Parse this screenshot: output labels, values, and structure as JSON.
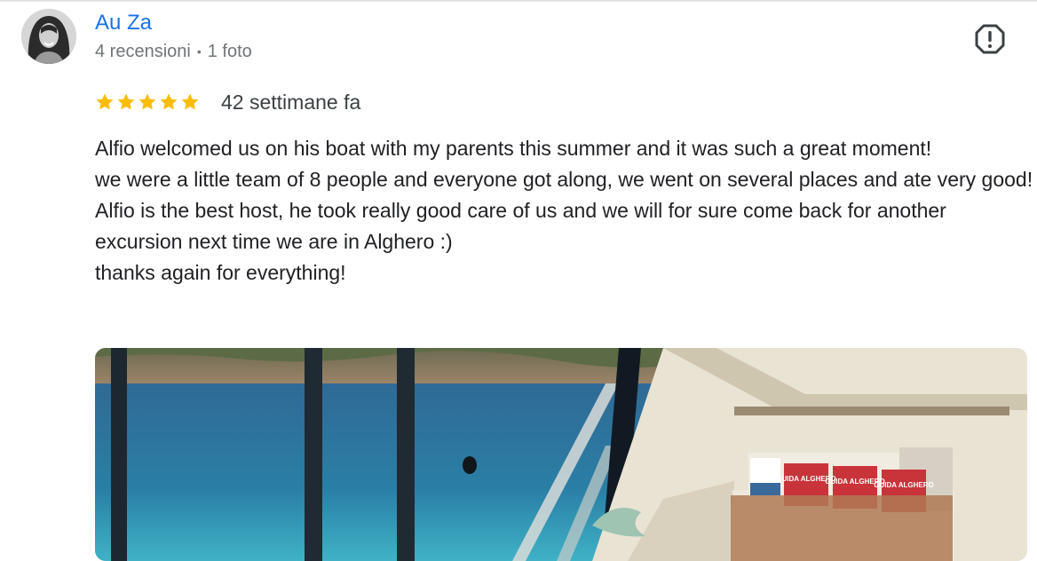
{
  "review": {
    "author_name": "Au Za",
    "author_reviews": "4 recensioni",
    "separator": "•",
    "author_photos": "1 foto",
    "rating": 5,
    "rating_max": 5,
    "time_ago": "42 settimane fa",
    "text_lines": [
      "Alfio welcomed us on his boat with my parents this summer and it was such a great moment!",
      "we were a little team of 8 people and everyone got along, we went on several places and ate very good!",
      "Alfio is the best host, he took really good care of us and we will for sure come back for another excursion next time we are in Alghero :)",
      "thanks again for everything!"
    ]
  },
  "photo": {
    "sign_labels": [
      "GUIDA ALGHERO",
      "GUIDA ALGHERO",
      "GUIDA ALGHERO"
    ]
  },
  "icons": {
    "report": "report-icon",
    "star": "star-icon",
    "avatar": "avatar"
  },
  "colors": {
    "link": "#1a73e8",
    "star": "#fbbc04",
    "muted": "#70757a",
    "text": "#202124"
  }
}
